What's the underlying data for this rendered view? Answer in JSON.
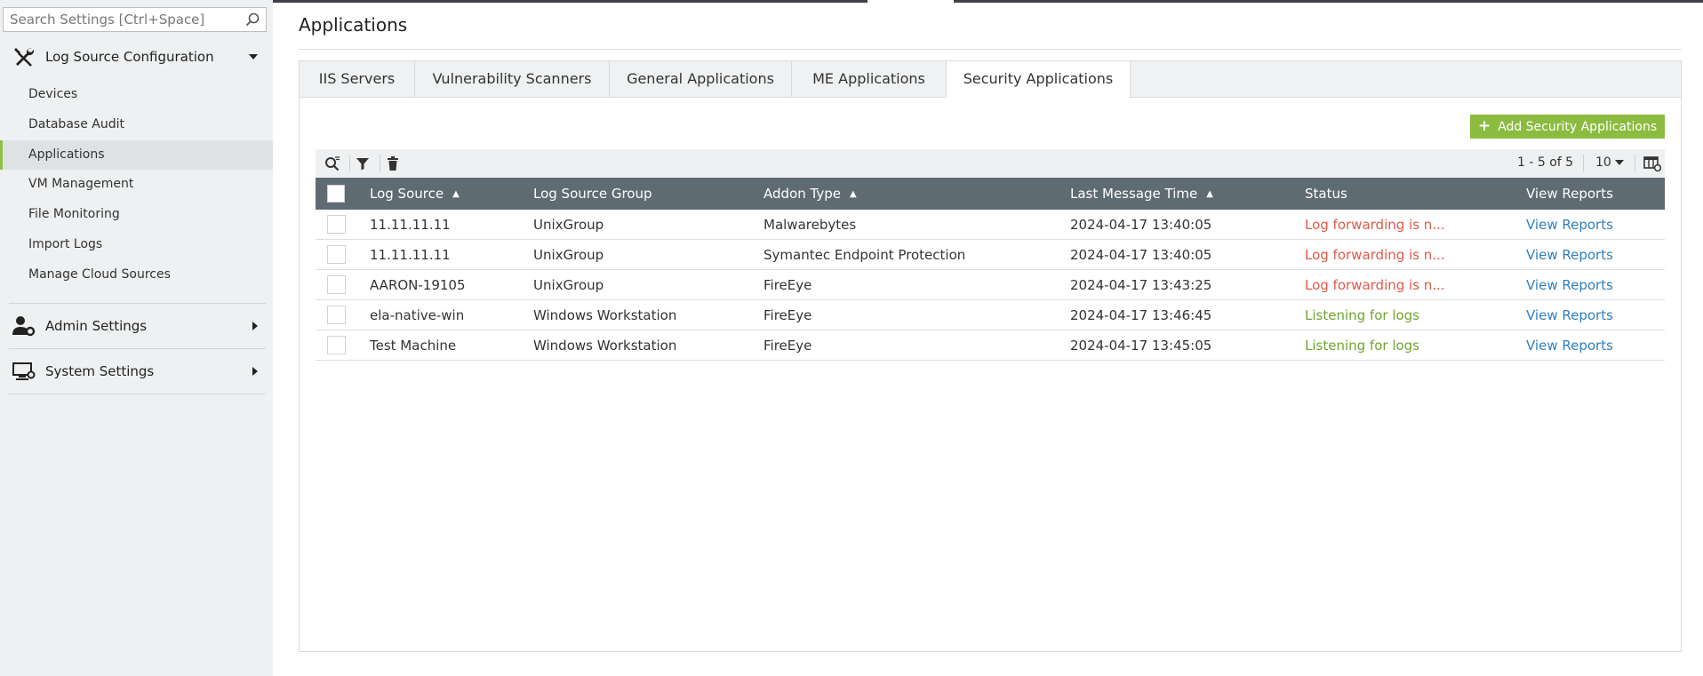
{
  "search": {
    "placeholder": "Search Settings [Ctrl+Space]"
  },
  "sidebar": {
    "log_source_config": {
      "label": "Log Source Configuration",
      "items": [
        {
          "label": "Devices"
        },
        {
          "label": "Database Audit"
        },
        {
          "label": "Applications"
        },
        {
          "label": "VM Management"
        },
        {
          "label": "File Monitoring"
        },
        {
          "label": "Import Logs"
        },
        {
          "label": "Manage Cloud Sources"
        }
      ]
    },
    "admin_settings": {
      "label": "Admin Settings"
    },
    "system_settings": {
      "label": "System Settings"
    }
  },
  "main": {
    "title": "Applications",
    "tabs": [
      {
        "label": "IIS Servers"
      },
      {
        "label": "Vulnerability Scanners"
      },
      {
        "label": "General Applications"
      },
      {
        "label": "ME Applications"
      },
      {
        "label": "Security Applications"
      }
    ],
    "active_tab": "Security Applications",
    "add_button": "Add Security Applications",
    "pager": "1 - 5 of 5",
    "per_page": "10",
    "columns": [
      "Log Source",
      "Log Source Group",
      "Addon Type",
      "Last Message Time",
      "Status",
      "View Reports"
    ],
    "rows": [
      {
        "log_source": "11.11.11.11",
        "group": "UnixGroup",
        "addon": "Malwarebytes",
        "time": "2024-04-17 13:40:05",
        "status": "Log forwarding is n...",
        "status_type": "error",
        "report": "View Reports"
      },
      {
        "log_source": "11.11.11.11",
        "group": "UnixGroup",
        "addon": "Symantec Endpoint Protection",
        "time": "2024-04-17 13:40:05",
        "status": "Log forwarding is n...",
        "status_type": "error",
        "report": "View Reports"
      },
      {
        "log_source": "AARON-19105",
        "group": "UnixGroup",
        "addon": "FireEye",
        "time": "2024-04-17 13:43:25",
        "status": "Log forwarding is n...",
        "status_type": "error",
        "report": "View Reports"
      },
      {
        "log_source": "ela-native-win",
        "group": "Windows Workstation",
        "addon": "FireEye",
        "time": "2024-04-17 13:46:45",
        "status": "Listening for logs",
        "status_type": "ok",
        "report": "View Reports"
      },
      {
        "log_source": "Test Machine",
        "group": "Windows Workstation",
        "addon": "FireEye",
        "time": "2024-04-17 13:45:05",
        "status": "Listening for logs",
        "status_type": "ok",
        "report": "View Reports"
      }
    ]
  },
  "colors": {
    "accent_green": "#8cbc3f",
    "status_error": "#e05a48",
    "status_ok": "#6ea62e",
    "link": "#2f7fc1",
    "table_header": "#5f6b72"
  }
}
